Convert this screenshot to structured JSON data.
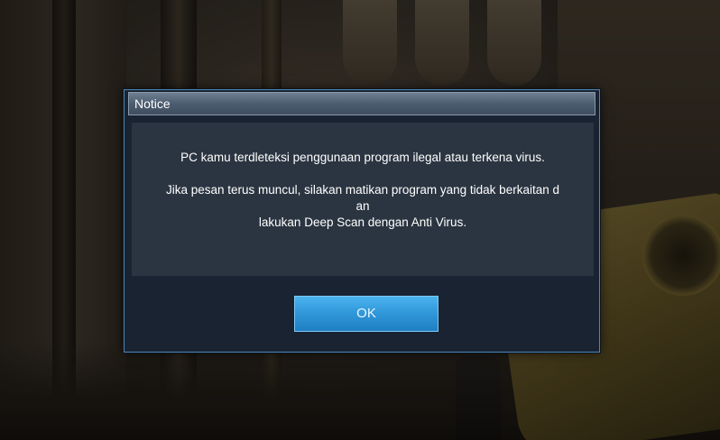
{
  "dialog": {
    "title": "Notice",
    "message": {
      "line1": "PC kamu terdleteksi penggunaan program ilegal atau terkena virus.",
      "line2": "Jika pesan terus muncul, silakan matikan program yang tidak berkaitan d",
      "line3": "an",
      "line4": "lakukan Deep Scan dengan Anti Virus."
    },
    "ok_label": "OK"
  },
  "colors": {
    "dialog_border": "#4b87b6",
    "dialog_bg": "#1a2331",
    "body_bg": "#2b3541",
    "button_accent": "#2f96d8"
  }
}
